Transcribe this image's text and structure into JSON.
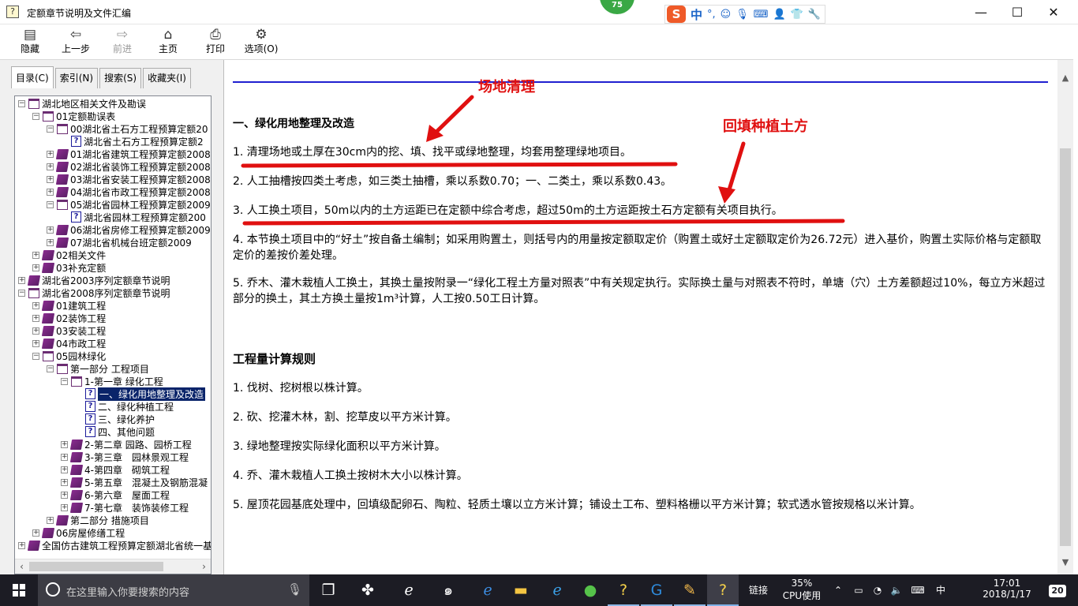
{
  "window": {
    "title": "定额章节说明及文件汇编",
    "badge": "75",
    "minimize": "—",
    "maximize": "☐",
    "close": "✕"
  },
  "ime": {
    "logo": "S",
    "mode": "中",
    "punct": "°,"
  },
  "toolbar": {
    "hide": "隐藏",
    "back": "上一步",
    "forward": "前进",
    "home": "主页",
    "print": "打印",
    "options": "选项(O)"
  },
  "tabs": [
    "目录(C)",
    "索引(N)",
    "搜索(S)",
    "收藏夹(I)"
  ],
  "tree": [
    {
      "level": 0,
      "exp": "−",
      "icon": "open",
      "label": "湖北地区相关文件及勘误"
    },
    {
      "level": 1,
      "exp": "−",
      "icon": "open",
      "label": "01定额勘误表"
    },
    {
      "level": 2,
      "exp": "−",
      "icon": "open",
      "label": "00湖北省土石方工程预算定额20"
    },
    {
      "level": 3,
      "exp": "",
      "icon": "doc",
      "label": "湖北省土石方工程预算定额2"
    },
    {
      "level": 2,
      "exp": "+",
      "icon": "closed",
      "label": "01湖北省建筑工程预算定额2008"
    },
    {
      "level": 2,
      "exp": "+",
      "icon": "closed",
      "label": "02湖北省装饰工程预算定额2008"
    },
    {
      "level": 2,
      "exp": "+",
      "icon": "closed",
      "label": "03湖北省安装工程预算定额2008"
    },
    {
      "level": 2,
      "exp": "+",
      "icon": "closed",
      "label": "04湖北省市政工程预算定额2008"
    },
    {
      "level": 2,
      "exp": "−",
      "icon": "open",
      "label": "05湖北省园林工程预算定额2009"
    },
    {
      "level": 3,
      "exp": "",
      "icon": "doc",
      "label": "湖北省园林工程预算定额200"
    },
    {
      "level": 2,
      "exp": "+",
      "icon": "closed",
      "label": "06湖北省房修工程预算定额2009"
    },
    {
      "level": 2,
      "exp": "+",
      "icon": "closed",
      "label": "07湖北省机械台班定额2009"
    },
    {
      "level": 1,
      "exp": "+",
      "icon": "closed",
      "label": "02相关文件"
    },
    {
      "level": 1,
      "exp": "+",
      "icon": "closed",
      "label": "03补充定额"
    },
    {
      "level": 0,
      "exp": "+",
      "icon": "closed",
      "label": "湖北省2003序列定额章节说明"
    },
    {
      "level": 0,
      "exp": "−",
      "icon": "open",
      "label": "湖北省2008序列定额章节说明"
    },
    {
      "level": 1,
      "exp": "+",
      "icon": "closed",
      "label": "01建筑工程"
    },
    {
      "level": 1,
      "exp": "+",
      "icon": "closed",
      "label": "02装饰工程"
    },
    {
      "level": 1,
      "exp": "+",
      "icon": "closed",
      "label": "03安装工程"
    },
    {
      "level": 1,
      "exp": "+",
      "icon": "closed",
      "label": "04市政工程"
    },
    {
      "level": 1,
      "exp": "−",
      "icon": "open",
      "label": "05园林绿化"
    },
    {
      "level": 2,
      "exp": "−",
      "icon": "open",
      "label": "第一部分 工程项目"
    },
    {
      "level": 3,
      "exp": "−",
      "icon": "open",
      "label": "1-第一章 绿化工程"
    },
    {
      "level": 4,
      "exp": "",
      "icon": "doc",
      "label": "一、绿化用地整理及改造",
      "selected": true
    },
    {
      "level": 4,
      "exp": "",
      "icon": "doc",
      "label": "二、绿化种植工程"
    },
    {
      "level": 4,
      "exp": "",
      "icon": "doc",
      "label": "三、绿化养护"
    },
    {
      "level": 4,
      "exp": "",
      "icon": "doc",
      "label": "四、其他问题"
    },
    {
      "level": 3,
      "exp": "+",
      "icon": "closed",
      "label": "2-第二章 园路、园桥工程"
    },
    {
      "level": 3,
      "exp": "+",
      "icon": "closed",
      "label": "3-第三章　园林景观工程"
    },
    {
      "level": 3,
      "exp": "+",
      "icon": "closed",
      "label": "4-第四章　砌筑工程"
    },
    {
      "level": 3,
      "exp": "+",
      "icon": "closed",
      "label": "5-第五章　混凝土及钢筋混凝"
    },
    {
      "level": 3,
      "exp": "+",
      "icon": "closed",
      "label": "6-第六章　屋面工程"
    },
    {
      "level": 3,
      "exp": "+",
      "icon": "closed",
      "label": "7-第七章　装饰装修工程"
    },
    {
      "level": 2,
      "exp": "+",
      "icon": "closed",
      "label": "第二部分 措施项目"
    },
    {
      "level": 1,
      "exp": "+",
      "icon": "closed",
      "label": "06房屋修缮工程"
    },
    {
      "level": 0,
      "exp": "+",
      "icon": "closed",
      "label": "全国仿古建筑工程预算定额湖北省统一基"
    }
  ],
  "content": {
    "section_title": "一、绿化用地整理及改造",
    "items": [
      "1. 清理场地或土厚在30cm内的挖、填、找平或绿地整理，均套用整理绿地项目。",
      "2. 人工抽槽按四类土考虑，如三类土抽槽，乘以系数0.70；一、二类土，乘以系数0.43。",
      "3. 人工换土项目，50m以内的土方运距已在定额中综合考虑，超过50m的土方运距按土石方定额有关项目执行。",
      "4. 本节换土项目中的“好土”按自备土编制；如采用购置土，则括号内的用量按定额取定价（购置土或好土定额取定价为26.72元）进入基价，购置土实际价格与定额取定价的差按价差处理。",
      "5. 乔木、灌木栽植人工换土，其换土量按附录一“绿化工程土方量对照表”中有关规定执行。实际换土量与对照表不符时，单塘（穴）土方差额超过10%，每立方米超过部分的换土，其土方换土量按1m³计算，人工按0.50工日计算。"
    ],
    "rules_title": "工程量计算规则",
    "rules": [
      "1. 伐树、挖树根以株计算。",
      "2. 砍、挖灌木林，割、挖草皮以平方米计算。",
      "3. 绿地整理按实际绿化面积以平方米计算。",
      "4. 乔、灌木栽植人工换土按树木大小以株计算。",
      "5. 屋顶花园基底处理中，回填级配卵石、陶粒、轻质土壤以立方米计算；铺设土工布、塑料格栅以平方米计算；软式透水管按规格以米计算。"
    ]
  },
  "annotations": {
    "label1": "场地清理",
    "label2": "回填种植土方",
    "color": "#e01010"
  },
  "taskbar": {
    "search_placeholder": "在这里输入你要搜索的内容",
    "cpu_percent": "35%",
    "cpu_label": "CPU使用",
    "link_label": "链接",
    "ime_label": "中",
    "time": "17:01",
    "date": "2018/1/17",
    "notifications": "20"
  },
  "colors": {
    "accent": "#2020d0",
    "selection": "#0a246a",
    "taskbar": "#1c1c24"
  }
}
